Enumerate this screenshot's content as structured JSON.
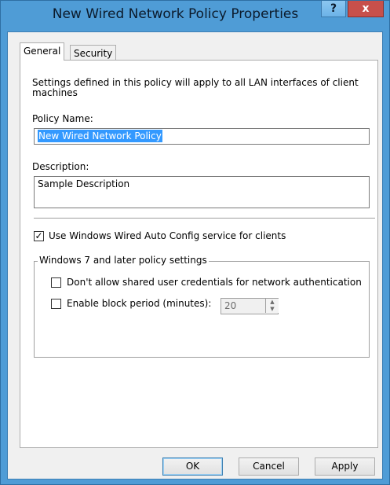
{
  "window": {
    "title": "New Wired Network Policy Properties",
    "help_label": "?",
    "close_label": "x"
  },
  "tabs": [
    {
      "label": "General",
      "active": true
    },
    {
      "label": "Security",
      "active": false
    }
  ],
  "general": {
    "intro_text": "Settings defined in this policy will apply to all LAN interfaces of client machines",
    "policy_name_label": "Policy Name:",
    "policy_name_value": "New Wired Network Policy",
    "description_label": "Description:",
    "description_value": "Sample Description",
    "auto_config_checked": true,
    "auto_config_label": "Use Windows Wired Auto Config service for clients",
    "group_title": "Windows 7 and later policy settings",
    "shared_credentials_checked": false,
    "shared_credentials_label": "Don't allow shared user credentials for network authentication",
    "block_period_checked": false,
    "block_period_label": "Enable block period (minutes):",
    "block_period_value": "20"
  },
  "buttons": {
    "ok": "OK",
    "cancel": "Cancel",
    "apply": "Apply"
  },
  "colors": {
    "title_bar": "#4f9cd6",
    "close_button": "#c7504b",
    "selection": "#3399ff"
  }
}
